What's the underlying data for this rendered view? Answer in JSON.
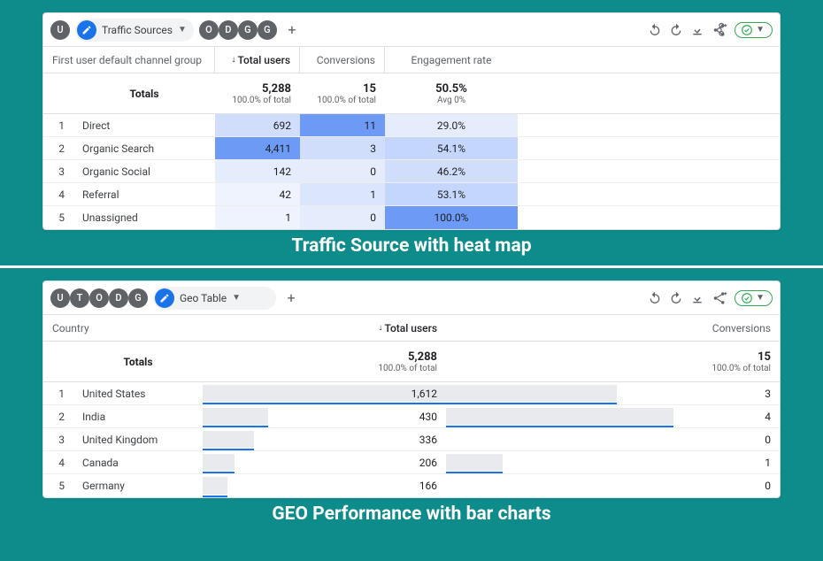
{
  "panel1": {
    "toolbar": {
      "chips_left": [
        "U"
      ],
      "active_segment": "Traffic Sources",
      "chips_right": [
        "O",
        "D",
        "G",
        "G"
      ]
    },
    "columns": {
      "dim": "First user default channel group",
      "m1": "Total users",
      "m2": "Conversions",
      "m3": "Engagement rate"
    },
    "totals_label": "Totals",
    "totals": {
      "m1": "5,288",
      "m1_sub": "100.0% of total",
      "m2": "15",
      "m2_sub": "100.0% of total",
      "m3": "50.5%",
      "m3_sub": "Avg 0%"
    },
    "rows": [
      {
        "idx": "1",
        "dim": "Direct",
        "m1": "692",
        "m2": "11",
        "m3": "29.0%",
        "h1": "#d0defb",
        "h2": "#6d9af5",
        "h3": "#e5edfd"
      },
      {
        "idx": "2",
        "dim": "Organic Search",
        "m1": "4,411",
        "m2": "3",
        "m3": "54.1%",
        "h1": "#6d9af5",
        "h2": "#d0defb",
        "h3": "#c4d6fb"
      },
      {
        "idx": "3",
        "dim": "Organic Social",
        "m1": "142",
        "m2": "0",
        "m3": "46.2%",
        "h1": "#e5edfd",
        "h2": "#e5edfd",
        "h3": "#d0defb"
      },
      {
        "idx": "4",
        "dim": "Referral",
        "m1": "42",
        "m2": "1",
        "m3": "53.1%",
        "h1": "#eef3fe",
        "h2": "#dbe5fc",
        "h3": "#c4d6fb"
      },
      {
        "idx": "5",
        "dim": "Unassigned",
        "m1": "1",
        "m2": "0",
        "m3": "100.0%",
        "h1": "#eef3fe",
        "h2": "#e5edfd",
        "h3": "#6d9af5"
      }
    ],
    "caption": "Traffic Source with heat map"
  },
  "panel2": {
    "toolbar": {
      "chips_left": [
        "U",
        "T",
        "O",
        "D",
        "G"
      ],
      "active_segment": "Geo Table"
    },
    "columns": {
      "dim": "Country",
      "m1": "Total users",
      "m2": "Conversions"
    },
    "totals_label": "Totals",
    "totals": {
      "m1": "5,288",
      "m1_sub": "100.0% of total",
      "m2": "15",
      "m2_sub": "100.0% of total"
    },
    "rows": [
      {
        "idx": "1",
        "dim": "United States",
        "m1": "1,612",
        "m2": "3",
        "b1": 100,
        "b2": 75,
        "r1": 100,
        "r2": 75
      },
      {
        "idx": "2",
        "dim": "India",
        "m1": "430",
        "m2": "4",
        "b1": 27,
        "b2": 100,
        "r1": 27,
        "r2": 100
      },
      {
        "idx": "3",
        "dim": "United Kingdom",
        "m1": "336",
        "m2": "0",
        "b1": 21,
        "b2": 0,
        "r1": 21,
        "r2": 0
      },
      {
        "idx": "4",
        "dim": "Canada",
        "m1": "206",
        "m2": "1",
        "b1": 13,
        "b2": 25,
        "r1": 13,
        "r2": 25
      },
      {
        "idx": "5",
        "dim": "Germany",
        "m1": "166",
        "m2": "0",
        "b1": 10,
        "b2": 0,
        "r1": 10,
        "r2": 0
      }
    ],
    "caption": "GEO Performance with bar charts"
  },
  "chart_data": [
    {
      "type": "heatmap",
      "title": "Traffic Source with heat map",
      "row_dimension": "First user default channel group",
      "columns": [
        "Total users",
        "Conversions",
        "Engagement rate"
      ],
      "categories": [
        "Direct",
        "Organic Search",
        "Organic Social",
        "Referral",
        "Unassigned"
      ],
      "series": [
        {
          "name": "Total users",
          "values": [
            692,
            4411,
            142,
            42,
            1
          ]
        },
        {
          "name": "Conversions",
          "values": [
            11,
            3,
            0,
            1,
            0
          ]
        },
        {
          "name": "Engagement rate",
          "values": [
            29.0,
            54.1,
            46.2,
            53.1,
            100.0
          ]
        }
      ],
      "totals": {
        "Total users": 5288,
        "Conversions": 15,
        "Engagement rate": 50.5
      }
    },
    {
      "type": "bar",
      "title": "GEO Performance with bar charts",
      "row_dimension": "Country",
      "categories": [
        "United States",
        "India",
        "United Kingdom",
        "Canada",
        "Germany"
      ],
      "series": [
        {
          "name": "Total users",
          "values": [
            1612,
            430,
            336,
            206,
            166
          ]
        },
        {
          "name": "Conversions",
          "values": [
            3,
            4,
            0,
            1,
            0
          ]
        }
      ],
      "totals": {
        "Total users": 5288,
        "Conversions": 15
      }
    }
  ]
}
